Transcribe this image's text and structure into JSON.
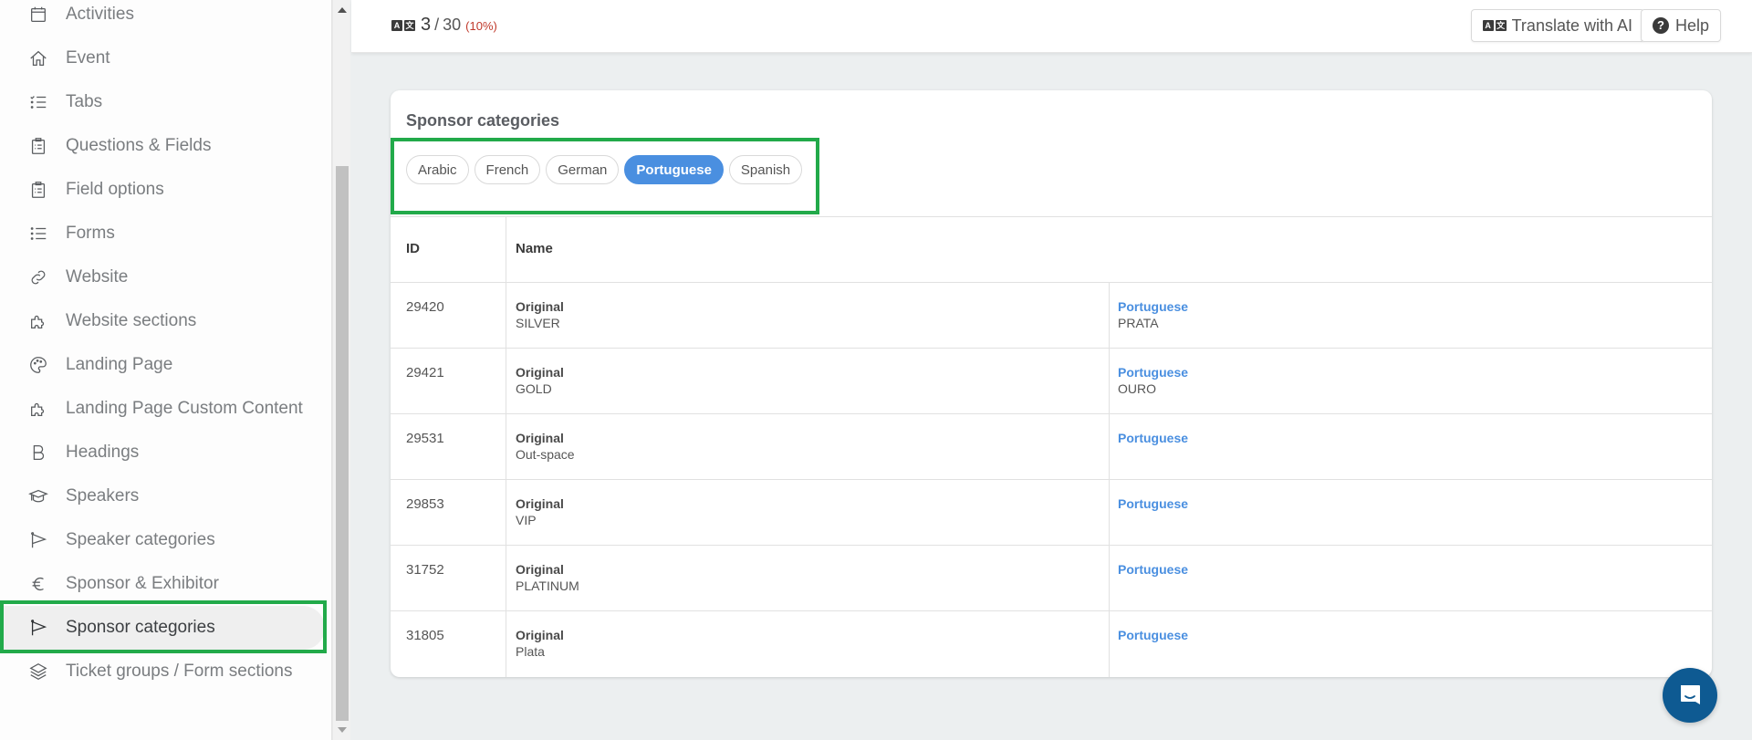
{
  "sidebar": {
    "items": [
      {
        "label": "Activities",
        "icon": "calendar-icon"
      },
      {
        "label": "Event",
        "icon": "home-icon"
      },
      {
        "label": "Tabs",
        "icon": "checklist-icon"
      },
      {
        "label": "Questions & Fields",
        "icon": "clipboard-icon"
      },
      {
        "label": "Field options",
        "icon": "clipboard-icon"
      },
      {
        "label": "Forms",
        "icon": "list-icon"
      },
      {
        "label": "Website",
        "icon": "link-icon"
      },
      {
        "label": "Website sections",
        "icon": "puzzle-icon"
      },
      {
        "label": "Landing Page",
        "icon": "palette-icon"
      },
      {
        "label": "Landing Page Custom Content",
        "icon": "puzzle-icon"
      },
      {
        "label": "Headings",
        "icon": "bold-b-icon"
      },
      {
        "label": "Speakers",
        "icon": "graduation-cap-icon"
      },
      {
        "label": "Speaker categories",
        "icon": "flag-icon"
      },
      {
        "label": "Sponsor & Exhibitor",
        "icon": "euro-icon"
      },
      {
        "label": "Sponsor categories",
        "icon": "flag-icon",
        "active": true
      },
      {
        "label": "Ticket groups / Form sections",
        "icon": "layers-icon"
      }
    ]
  },
  "topbar": {
    "progress": {
      "done": "3",
      "separator": "/",
      "total": "30",
      "percent": "(10%)"
    },
    "translate_ai_label": "Translate with AI",
    "help_label": "Help",
    "help_glyph": "?",
    "glyph_a": "A",
    "glyph_b": "文"
  },
  "card": {
    "title": "Sponsor categories",
    "languages": [
      {
        "label": "Arabic",
        "active": false
      },
      {
        "label": "French",
        "active": false
      },
      {
        "label": "German",
        "active": false
      },
      {
        "label": "Portuguese",
        "active": true
      },
      {
        "label": "Spanish",
        "active": false
      }
    ],
    "table": {
      "headers": {
        "id": "ID",
        "name": "Name"
      },
      "original_label": "Original",
      "translation_label": "Portuguese",
      "rows": [
        {
          "id": "29420",
          "original": "SILVER",
          "translation": "PRATA"
        },
        {
          "id": "29421",
          "original": "GOLD",
          "translation": "OURO"
        },
        {
          "id": "29531",
          "original": "Out-space",
          "translation": ""
        },
        {
          "id": "29853",
          "original": "VIP",
          "translation": ""
        },
        {
          "id": "31752",
          "original": "PLATINUM",
          "translation": ""
        },
        {
          "id": "31805",
          "original": "Plata",
          "translation": ""
        }
      ]
    }
  },
  "colors": {
    "accent": "#4a8fe0",
    "highlight": "#22aa4a",
    "percent": "#c0392b",
    "chat": "#0e5a92"
  }
}
